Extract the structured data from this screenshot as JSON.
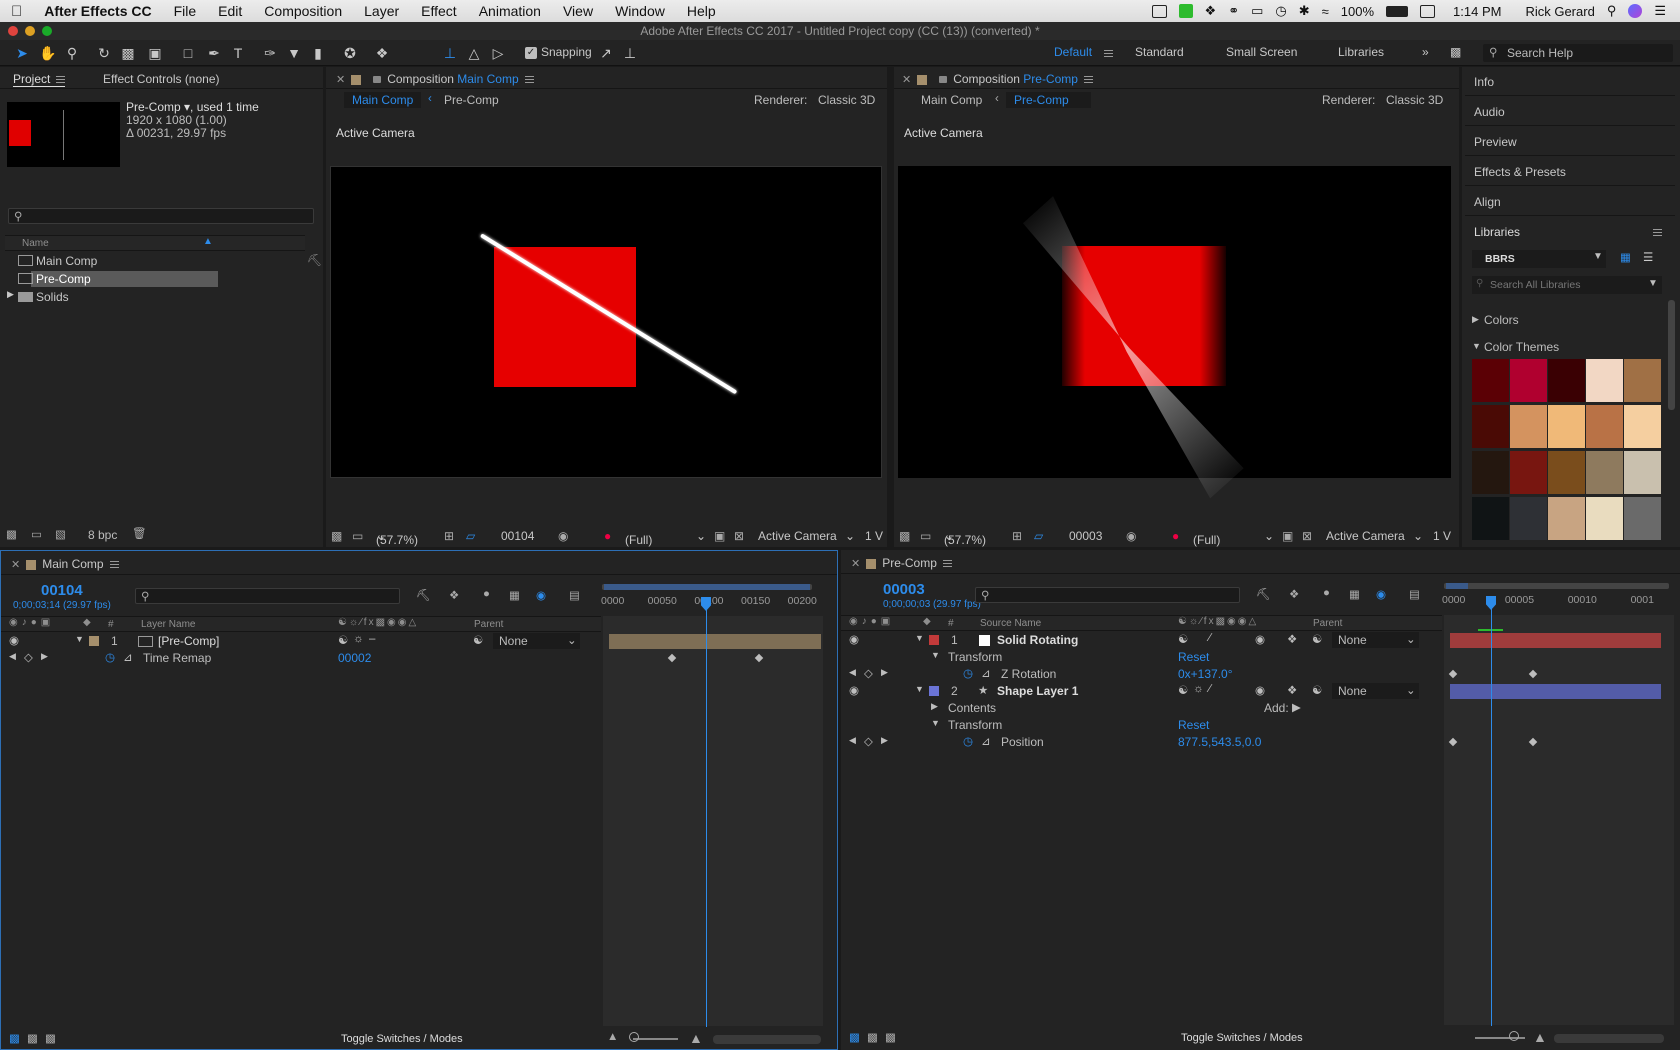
{
  "menubar": {
    "app": "After Effects CC",
    "items": [
      "File",
      "Edit",
      "Composition",
      "Layer",
      "Effect",
      "Animation",
      "View",
      "Window",
      "Help"
    ],
    "battery": "100%",
    "time": "1:14 PM",
    "user": "Rick Gerard"
  },
  "window_title": "Adobe After Effects CC 2017 - Untitled Project copy (CC (13)) (converted) *",
  "toolbar": {
    "snapping": "Snapping",
    "workspaces": [
      "Default",
      "Standard",
      "Small Screen",
      "Libraries"
    ],
    "search_help": "Search Help"
  },
  "project": {
    "tab_project": "Project",
    "tab_effect_controls": "Effect Controls (none)",
    "item_name": "Pre-Comp",
    "item_used": ", used 1 time",
    "item_size": "1920 x 1080 (1.00)",
    "item_duration": "Δ 00231, 29.97 fps",
    "col_name": "Name",
    "items": [
      "Main Comp",
      "Pre-Comp",
      "Solids"
    ],
    "bpc": "8 bpc"
  },
  "viewer_left": {
    "tab_prefix": "Composition",
    "tab_comp": "Main Comp",
    "flow_active": "Main Comp",
    "flow_other": "Pre-Comp",
    "renderer_label": "Renderer:",
    "renderer": "Classic 3D",
    "camera_label": "Active Camera",
    "zoom": "(57.7%)",
    "frame": "00104",
    "resolution": "(Full)",
    "view": "Active Camera",
    "views": "1 V"
  },
  "viewer_right": {
    "tab_prefix": "Composition",
    "tab_comp": "Pre-Comp",
    "flow_other": "Main Comp",
    "flow_active": "Pre-Comp",
    "renderer_label": "Renderer:",
    "renderer": "Classic 3D",
    "camera_label": "Active Camera",
    "zoom": "(57.7%)",
    "frame": "00003",
    "resolution": "(Full)",
    "view": "Active Camera",
    "views": "1 V"
  },
  "right_panel": {
    "items": [
      "Info",
      "Audio",
      "Preview",
      "Effects & Presets",
      "Align"
    ],
    "libraries": "Libraries",
    "library_name": "BBRS",
    "search_libraries": "Search All Libraries",
    "colors": "Colors",
    "color_themes": "Color Themes",
    "theme_colors": [
      [
        "#5b0005",
        "#b0002f",
        "#3a0003",
        "#f2d7c4",
        "#a07045"
      ],
      [
        "#4a0a05",
        "#d4935f",
        "#f0b978",
        "#b97246",
        "#f5cfa0"
      ],
      [
        "#24170f",
        "#781610",
        "#7a4d1c",
        "#8e7a5e",
        "#c9c0ae"
      ],
      [
        "#101415",
        "#2e3035",
        "#c8a482",
        "#e9dcbf",
        "#6a6a6a"
      ]
    ]
  },
  "timeline_left": {
    "tab": "Main Comp",
    "timecode": "00104",
    "timecode_sub": "0;00;03;14 (29.97 fps)",
    "col_layer_name": "Layer Name",
    "col_parent": "Parent",
    "ruler": [
      "0000",
      "00050",
      "00100",
      "00150",
      "00200"
    ],
    "layer_num": "1",
    "layer_name": "[Pre-Comp]",
    "parent": "None",
    "prop_name": "Time Remap",
    "prop_value": "00002",
    "footer": "Toggle Switches / Modes"
  },
  "timeline_right": {
    "tab": "Pre-Comp",
    "timecode": "00003",
    "timecode_sub": "0;00;00;03 (29.97 fps)",
    "col_source_name": "Source Name",
    "col_parent": "Parent",
    "ruler": [
      "0000",
      "00005",
      "00010",
      "0001"
    ],
    "layer1_num": "1",
    "layer1_name": "Solid Rotating",
    "layer1_parent": "None",
    "transform": "Transform",
    "reset": "Reset",
    "zrot_name": "Z Rotation",
    "zrot_value": "0x+137.0°",
    "layer2_num": "2",
    "layer2_name": "Shape Layer 1",
    "layer2_parent": "None",
    "contents": "Contents",
    "add": "Add:",
    "position_name": "Position",
    "position_value": "877.5,543.5,0.0",
    "footer": "Toggle Switches / Modes"
  }
}
